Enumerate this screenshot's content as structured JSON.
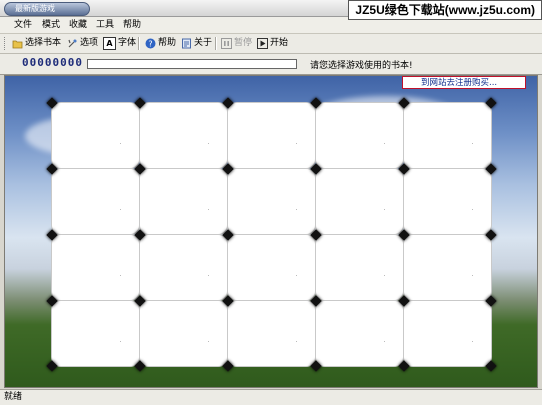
{
  "window": {
    "title": "最新版游戏"
  },
  "watermark": {
    "text": "JZ5U绿色下载站(www.jz5u.com)"
  },
  "menu": {
    "items": [
      {
        "label": "文件"
      },
      {
        "label": "模式"
      },
      {
        "label": "收藏"
      },
      {
        "label": "工具"
      },
      {
        "label": "帮助"
      }
    ]
  },
  "toolbar": {
    "select_book": "选择书本",
    "options": "选项",
    "font": "字体",
    "help": "帮助",
    "about": "关于",
    "pause": "暂停",
    "start": "开始",
    "font_icon_glyph": "A"
  },
  "status_row": {
    "counter": "00000000",
    "progress_percent": 0,
    "prompt": "请您选择游戏使用的书本!"
  },
  "game": {
    "register_link": "到网站去注册购买...",
    "grid": {
      "rows": 4,
      "cols": 5
    }
  },
  "statusbar": {
    "text": "就绪"
  },
  "colors": {
    "counter": "#1f2d7a",
    "link_border": "#c0102a",
    "link_text": "#102d8c"
  }
}
